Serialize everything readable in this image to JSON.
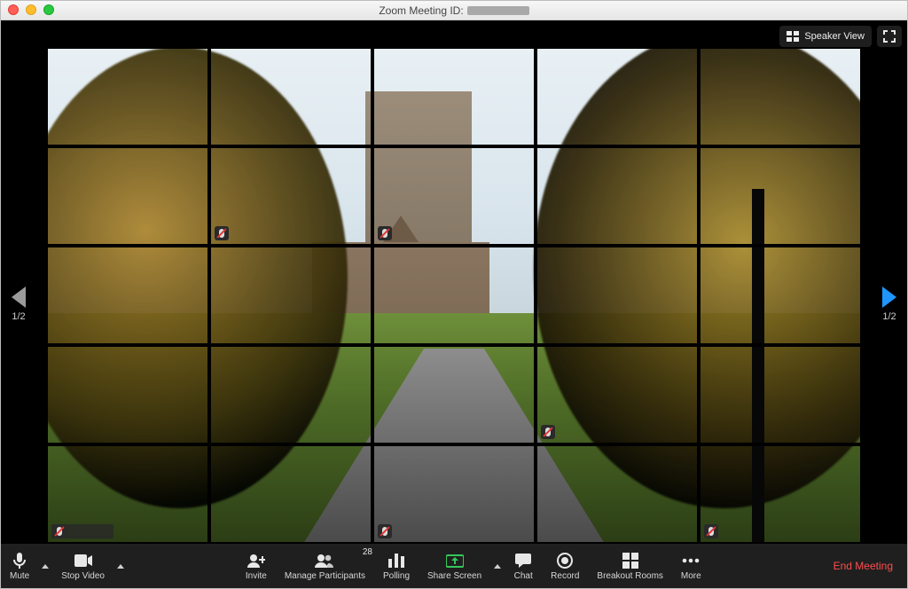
{
  "titlebar": {
    "prefix": "Zoom Meeting ID:",
    "id_masked": true
  },
  "view": {
    "speaker_view_label": "Speaker View",
    "fullscreen_label": "Enter Full Screen"
  },
  "pager": {
    "left": "1/2",
    "right": "1/2"
  },
  "grid": {
    "rows": 5,
    "cols": 5
  },
  "toolbar": {
    "mute": "Mute",
    "stop_video": "Stop Video",
    "invite": "Invite",
    "manage_participants": "Manage Participants",
    "participants_count": "28",
    "polling": "Polling",
    "share_screen": "Share Screen",
    "chat": "Chat",
    "record": "Record",
    "breakout_rooms": "Breakout Rooms",
    "more": "More",
    "end_meeting": "End Meeting"
  },
  "colors": {
    "accent_green": "#34c759",
    "accent_blue": "#1f96ff",
    "danger": "#ff4d4d"
  }
}
